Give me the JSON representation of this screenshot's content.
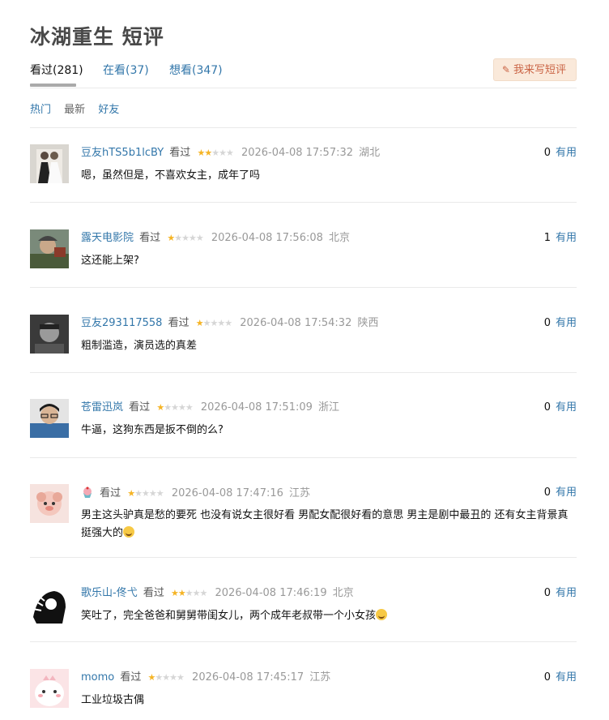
{
  "page": {
    "title": "冰湖重生 短评"
  },
  "tabs": [
    {
      "label": "看过(281)"
    },
    {
      "label": "在看(37)"
    },
    {
      "label": "想看(347)"
    }
  ],
  "write_button": {
    "label": "我来写短评",
    "icon": "pencil-icon"
  },
  "sorts": [
    {
      "label": "热门"
    },
    {
      "label": "最新"
    },
    {
      "label": "好友"
    }
  ],
  "useful_label": "有用",
  "colors": {
    "link": "#3377aa",
    "star": "#f5b425",
    "button_bg": "#fae9da",
    "button_text": "#ca6445"
  },
  "comments": [
    {
      "user": "豆友hTS5b1lcBY",
      "status": "看过",
      "rating": 2,
      "time": "2026-04-08 17:57:32",
      "location": "湖北",
      "votes": "0",
      "text": "嗯，虽然但是，不喜欢女主，成年了吗"
    },
    {
      "user": "露天电影院",
      "status": "看过",
      "rating": 1,
      "time": "2026-04-08 17:56:08",
      "location": "北京",
      "votes": "1",
      "text": "这还能上架?"
    },
    {
      "user": "豆友293117558",
      "status": "看过",
      "rating": 1,
      "time": "2026-04-08 17:54:32",
      "location": "陕西",
      "votes": "0",
      "text": "粗制滥造，演员选的真差"
    },
    {
      "user": "苍雷迅岚",
      "status": "看过",
      "rating": 1,
      "time": "2026-04-08 17:51:09",
      "location": "浙江",
      "votes": "0",
      "text": "牛逼，这狗东西是扳不倒的么?"
    },
    {
      "user": "",
      "status": "看过",
      "rating": 1,
      "time": "2026-04-08 17:47:16",
      "location": "江苏",
      "votes": "0",
      "text": "男主这头驴真是愁的要死 也没有说女主很好看 男配女配很好看的意思 男主是剧中最丑的 还有女主背景真挺强大的"
    },
    {
      "user": "歌乐山-佟弋",
      "status": "看过",
      "rating": 2,
      "time": "2026-04-08 17:46:19",
      "location": "北京",
      "votes": "0",
      "text": "笑吐了，完全爸爸和舅舅带闺女儿，两个成年老叔带一个小女孩"
    },
    {
      "user": "momo",
      "status": "看过",
      "rating": 1,
      "time": "2026-04-08 17:45:17",
      "location": "江苏",
      "votes": "0",
      "text": "工业垃圾古偶"
    }
  ]
}
